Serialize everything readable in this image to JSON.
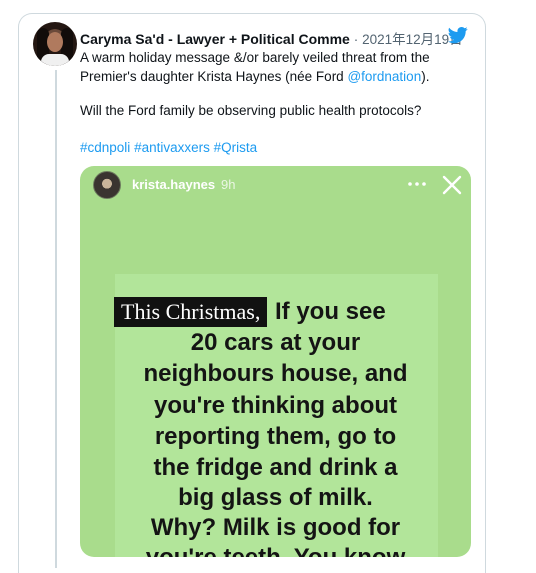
{
  "tweet": {
    "author_name": "Caryma Sa'd - Lawyer + Political Comme",
    "separator": "·",
    "date": "2021年12月19日",
    "line1": "A warm holiday message &/or barely veiled threat from the",
    "line2_text": "Premier's daughter Krista Haynes (née Ford ",
    "line2_mention": "@fordnation",
    "line2_end": ").",
    "line3": "Will the Ford family be observing public health protocols?",
    "hashtags": [
      "#cdnpoli",
      "#antivaxxers",
      "#Qrista"
    ]
  },
  "story": {
    "username": "krista.haynes",
    "time": "9h",
    "highlight_text": "This Christmas,",
    "lines": [
      "If you see",
      "20 cars at your",
      "neighbours house, and",
      "you're thinking about",
      "reporting them, go to",
      "the fridge and drink a",
      "big glass of milk.",
      "Why? Milk is good for",
      "you're teeth. You know"
    ]
  },
  "colors": {
    "link": "#1d9bf0",
    "story_background": "#a9dc8c",
    "twitter_blue": "#1d9bf0"
  },
  "icons": [
    "twitter-bird-icon",
    "more-dots-icon",
    "close-icon"
  ]
}
